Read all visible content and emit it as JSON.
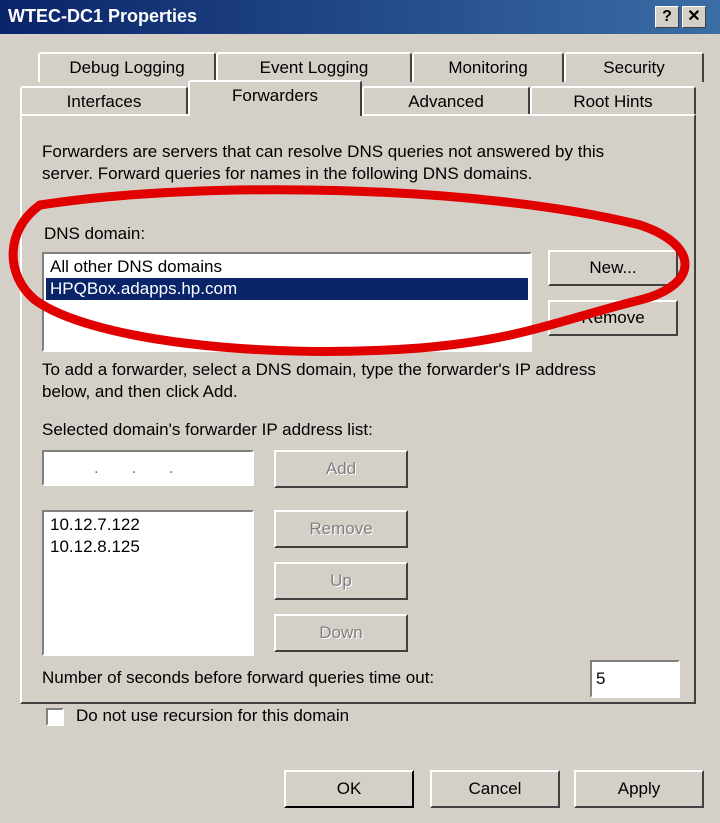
{
  "window": {
    "title": "WTEC-DC1 Properties",
    "help_glyph": "?",
    "close_glyph": "✕"
  },
  "tabs": {
    "row1": [
      "Debug Logging",
      "Event Logging",
      "Monitoring",
      "Security"
    ],
    "row2": [
      "Interfaces",
      "Forwarders",
      "Advanced",
      "Root Hints"
    ],
    "active": "Forwarders"
  },
  "forwarders": {
    "description": [
      "Forwarders are servers that can resolve DNS queries not answered by this",
      "server. Forward queries for names in the following DNS domains."
    ],
    "dns_domain_label": "DNS domain:",
    "domains": [
      "All other DNS domains",
      "HPQBox.adapps.hp.com"
    ],
    "selected_domain": "HPQBox.adapps.hp.com",
    "new_button": "New...",
    "remove_domain_button": "Remove",
    "instructions": [
      "To add a forwarder, select a DNS domain, type the forwarder's IP address",
      "below, and then click Add."
    ],
    "ip_list_label": "Selected domain's forwarder IP address list:",
    "ip_input_value": ". . .",
    "add_button": "Add",
    "ip_addresses": [
      "10.12.7.122",
      "10.12.8.125"
    ],
    "remove_ip_button": "Remove",
    "up_button": "Up",
    "down_button": "Down",
    "timeout_label": "Number of seconds before forward queries time out:",
    "timeout_value": "5",
    "recursion_label": "Do not use recursion for this domain",
    "recursion_checked": false
  },
  "footer": {
    "ok": "OK",
    "cancel": "Cancel",
    "apply": "Apply"
  },
  "colors": {
    "dialog_bg": "#d4d0c8",
    "title_bar": "#0a246a",
    "selection": "#0a246a",
    "annotation": "#e00000"
  }
}
